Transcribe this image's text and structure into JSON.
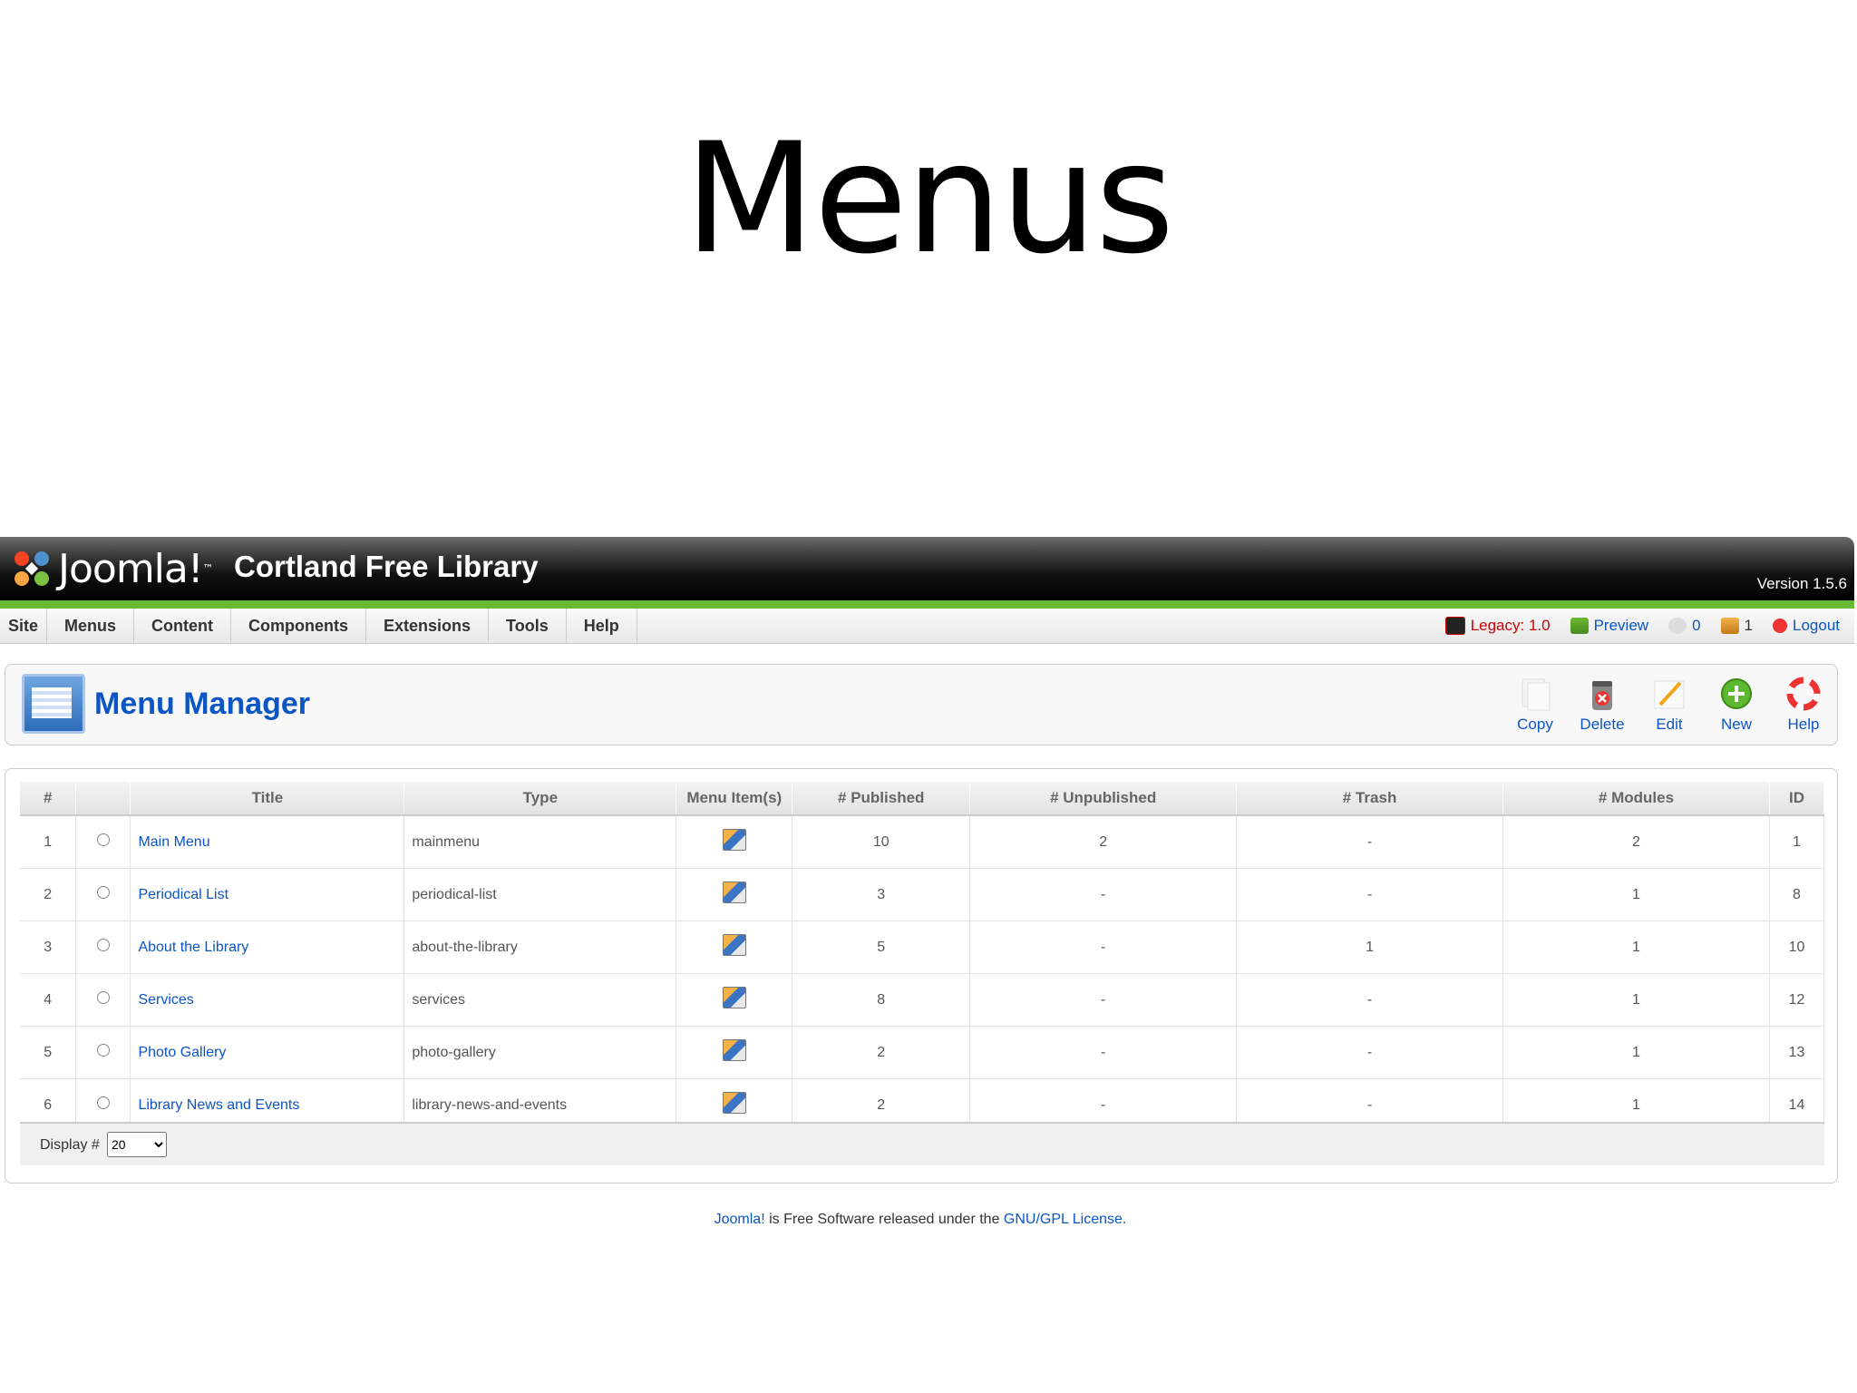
{
  "slide": {
    "title": "Menus"
  },
  "header": {
    "logo_text": "Joomla!",
    "logo_tm": "™",
    "site_name": "Cortland Free Library",
    "version": "Version 1.5.6"
  },
  "menubar": {
    "items": [
      "Site",
      "Menus",
      "Content",
      "Components",
      "Extensions",
      "Tools",
      "Help"
    ],
    "legacy": "Legacy: 1.0",
    "preview": "Preview",
    "messages": "0",
    "users": "1",
    "logout": "Logout"
  },
  "toolbar": {
    "title": "Menu Manager",
    "copy": "Copy",
    "delete": "Delete",
    "edit": "Edit",
    "new": "New",
    "help": "Help"
  },
  "table": {
    "headers": [
      "#",
      "",
      "Title",
      "Type",
      "Menu Item(s)",
      "# Published",
      "# Unpublished",
      "# Trash",
      "# Modules",
      "ID"
    ],
    "rows": [
      {
        "num": "1",
        "title": "Main Menu",
        "type": "mainmenu",
        "published": "10",
        "unpublished": "2",
        "trash": "-",
        "modules": "2",
        "id": "1"
      },
      {
        "num": "2",
        "title": "Periodical List",
        "type": "periodical-list",
        "published": "3",
        "unpublished": "-",
        "trash": "-",
        "modules": "1",
        "id": "8"
      },
      {
        "num": "3",
        "title": "About the Library",
        "type": "about-the-library",
        "published": "5",
        "unpublished": "-",
        "trash": "1",
        "modules": "1",
        "id": "10"
      },
      {
        "num": "4",
        "title": "Services",
        "type": "services",
        "published": "8",
        "unpublished": "-",
        "trash": "-",
        "modules": "1",
        "id": "12"
      },
      {
        "num": "5",
        "title": "Photo Gallery",
        "type": "photo-gallery",
        "published": "2",
        "unpublished": "-",
        "trash": "-",
        "modules": "1",
        "id": "13"
      },
      {
        "num": "6",
        "title": "Library News and Events",
        "type": "library-news-and-events",
        "published": "2",
        "unpublished": "-",
        "trash": "-",
        "modules": "1",
        "id": "14"
      }
    ]
  },
  "pagination": {
    "label": "Display #",
    "value": "20"
  },
  "credits": {
    "joomla": "Joomla!",
    "middle": " is Free Software released under the ",
    "license": "GNU/GPL License",
    "end": "."
  },
  "icons": {
    "copy": "copy-icon",
    "delete": "delete-icon",
    "edit": "edit-icon",
    "new": "new-icon",
    "help": "help-icon",
    "menu_items": "menu-items-icon",
    "menu_manager": "menu-manager-icon"
  },
  "colors": {
    "link": "#0b55c4",
    "accent_green": "#6ab934",
    "legacy_red": "#cc0000"
  }
}
